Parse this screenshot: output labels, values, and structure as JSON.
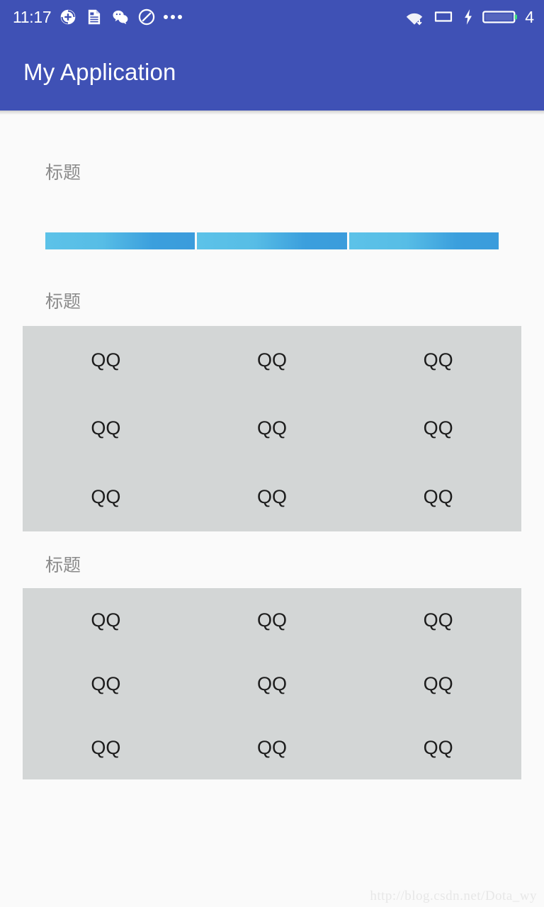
{
  "status_bar": {
    "time": "11:17",
    "battery_level_text": "4",
    "left_icons": [
      {
        "name": "sync-add-icon"
      },
      {
        "name": "document-icon"
      },
      {
        "name": "wechat-icon"
      },
      {
        "name": "do-not-disturb-icon"
      },
      {
        "name": "more-dots-icon"
      }
    ],
    "right_icons": [
      {
        "name": "wifi-download-icon"
      },
      {
        "name": "sim-card-icon"
      },
      {
        "name": "charging-bolt-icon"
      },
      {
        "name": "battery-icon"
      }
    ],
    "background_color": "#3f51b5"
  },
  "app_bar": {
    "title": "My Application",
    "background_color": "#3f51b5",
    "title_color": "#ffffff"
  },
  "sections": [
    {
      "label": "标题"
    },
    {
      "label": "标题"
    },
    {
      "label": "标题"
    }
  ],
  "segmented_bar": {
    "segment_count": 3,
    "gradient_start_color": "#5cc2e8",
    "gradient_end_color": "#3b9cdc",
    "segments": [
      {
        "name": "segment-1"
      },
      {
        "name": "segment-2"
      },
      {
        "name": "segment-3"
      }
    ]
  },
  "grids": [
    {
      "name": "grid-panel-1",
      "background_color": "#d3d6d6",
      "columns": 3,
      "rows": 3,
      "cells": [
        "QQ",
        "QQ",
        "QQ",
        "QQ",
        "QQ",
        "QQ",
        "QQ",
        "QQ",
        "QQ"
      ]
    },
    {
      "name": "grid-panel-2",
      "background_color": "#d3d6d6",
      "columns": 3,
      "rows": 3,
      "cells": [
        "QQ",
        "QQ",
        "QQ",
        "QQ",
        "QQ",
        "QQ",
        "QQ",
        "QQ",
        "QQ"
      ]
    }
  ],
  "watermark": {
    "text": "http://blog.csdn.net/Dota_wy"
  },
  "page": {
    "background_color": "#fafafa"
  }
}
